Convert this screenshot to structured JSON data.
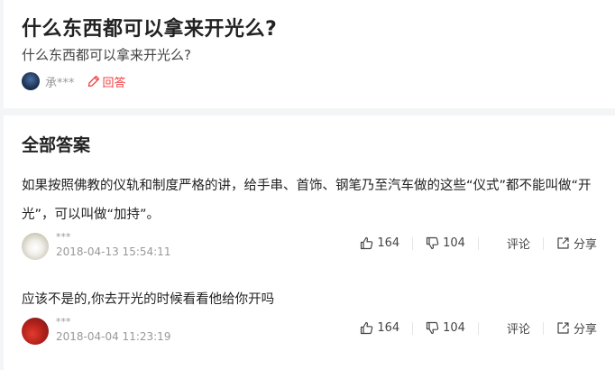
{
  "question": {
    "title": "什么东西都可以拿来开光么?",
    "description": "什么东西都可以拿来开光么?",
    "author": "承***",
    "answer_label": "回答"
  },
  "answers_section": {
    "title": "全部答案",
    "answers": [
      {
        "text": "如果按照佛教的仪轨和制度严格的讲，给手串、首饰、钢笔乃至汽车做的这些“仪式”都不能叫做“开光”，可以叫做“加持”。",
        "author": "***",
        "time": "2018-04-13 15:54:11",
        "likes": "164",
        "dislikes": "104",
        "comment_label": "评论",
        "share_label": "分享"
      },
      {
        "text": "应该不是的,你去开光的时候看看他给你开吗",
        "author": "***",
        "time": "2018-04-04 11:23:19",
        "likes": "164",
        "dislikes": "104",
        "comment_label": "评论",
        "share_label": "分享"
      }
    ]
  },
  "colors": {
    "accent": "#f04142",
    "muted": "#999999",
    "background": "#f4f5f6"
  },
  "icons": [
    "pencil-icon",
    "thumbs-up-icon",
    "thumbs-down-icon",
    "share-icon"
  ]
}
